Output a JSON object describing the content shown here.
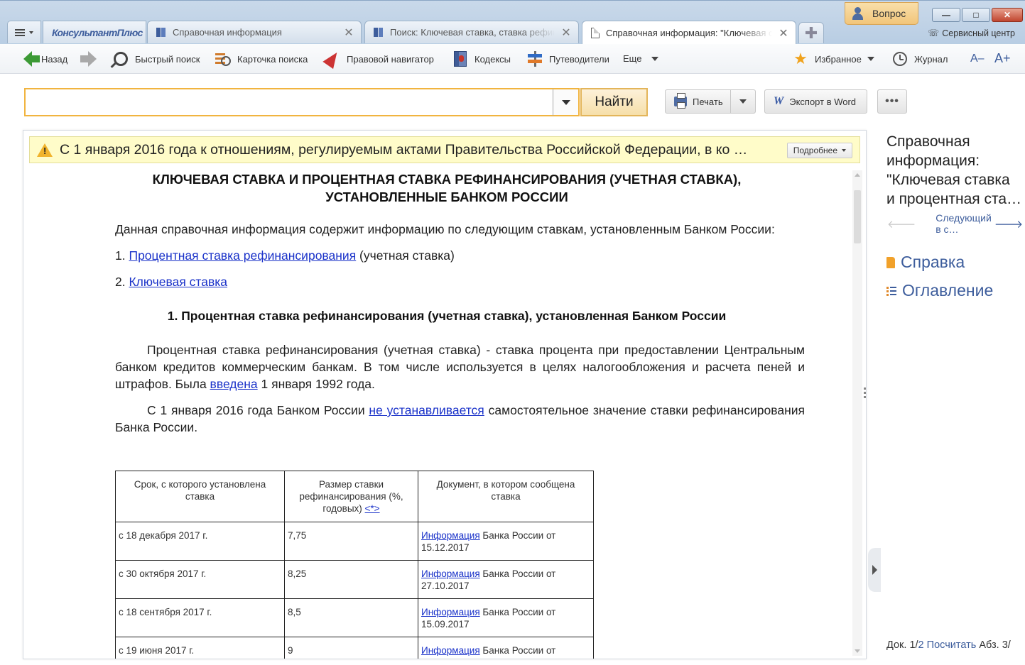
{
  "tabs": {
    "logo": "КонсультантПлюс",
    "items": [
      {
        "title": "Справочная информация",
        "icon": "book-icon"
      },
      {
        "title": "Поиск: Ключевая ставка, ставка рефинансирования",
        "icon": "book-icon"
      },
      {
        "title": "Справочная информация: \"Ключевая ставка",
        "icon": "page-icon"
      }
    ],
    "close_glyph": "✕",
    "new_tab_glyph": "✚"
  },
  "window": {
    "question_label": "Вопрос",
    "service_center_label": "Сервисный центр",
    "minimize": "—",
    "maximize": "□",
    "close": "✕"
  },
  "toolbar": {
    "back_label": "Назад",
    "quick_search_label": "Быстрый поиск",
    "search_card_label": "Карточка поиска",
    "legal_navigator_label": "Правовой навигатор",
    "codes_label": "Кодексы",
    "guides_label": "Путеводители",
    "more_label": "Еще",
    "favorites_label": "Избранное",
    "journal_label": "Журнал",
    "font_smaller": "A–",
    "font_larger": "A+"
  },
  "search": {
    "value": "",
    "placeholder": "",
    "find_label": "Найти"
  },
  "actions": {
    "print_label": "Печать",
    "export_label": "Экспорт в Word",
    "word_glyph": "W",
    "more_glyph": "•••"
  },
  "notice": {
    "text": "С 1 января 2016 года к отношениям, регулируемым актами Правительства Российской Федерации, в ко …",
    "details_label": "Подробнее"
  },
  "document": {
    "title_line1": "КЛЮЧЕВАЯ СТАВКА И ПРОЦЕНТНАЯ СТАВКА РЕФИНАНСИРОВАНИЯ (УЧЕТНАЯ СТАВКА),",
    "title_line2": "УСТАНОВЛЕННЫЕ БАНКОМ РОССИИ",
    "intro": "Данная справочная информация содержит информацию по следующим ставкам, установленным Банком России:",
    "list": [
      {
        "num": "1.",
        "link": "Процентная ставка рефинансирования",
        "rest": " (учетная ставка)"
      },
      {
        "num": "2.",
        "link": "Ключевая ставка",
        "rest": ""
      }
    ],
    "section1_heading": "1. Процентная ставка рефинансирования (учетная ставка), установленная Банком России",
    "p1_text": "Процентная ставка рефинансирования (учетная ставка) - ставка процента при предоставлении Центральным банком кредитов коммерческим банкам. В том числе используется в целях налогообложения и расчета пеней и штрафов. Была ",
    "p1_link": "введена",
    "p1_tail": " 1 января 1992 года.",
    "p2_start": "С 1 января 2016 года Банком России ",
    "p2_link": "не устанавливается",
    "p2_tail": " самостоятельное значение ставки рефинансирования Банка России.",
    "table": {
      "headers": [
        "Срок, с которого установлена ставка",
        "Размер ставки рефинансирования (%, годовых)",
        "Документ, в котором сообщена ставка"
      ],
      "header_note_link": "<*>",
      "rows": [
        {
          "date": "с 18 декабря 2017 г.",
          "rate": "7,75",
          "doc_link": "Информация",
          "doc_text": " Банка России от 15.12.2017"
        },
        {
          "date": "с 30 октября 2017 г.",
          "rate": "8,25",
          "doc_link": "Информация",
          "doc_text": " Банка России от 27.10.2017"
        },
        {
          "date": "с 18 сентября 2017 г.",
          "rate": "8,5",
          "doc_link": "Информация",
          "doc_text": " Банка России от 15.09.2017"
        },
        {
          "date": "с 19 июня 2017 г.",
          "rate": "9",
          "doc_link": "Информация",
          "doc_text": " Банка России от"
        }
      ]
    }
  },
  "right_panel": {
    "title_lines": [
      "Справочная",
      "информация:",
      "\"Ключевая ставка",
      "и процентная ста…"
    ],
    "next_label": "Следующий в с…",
    "help_label": "Справка",
    "toc_label": "Оглавление",
    "status_doc": "Док. 1/",
    "status_total": "2",
    "status_count": "Посчитать",
    "status_abz": "Абз. 3/"
  }
}
